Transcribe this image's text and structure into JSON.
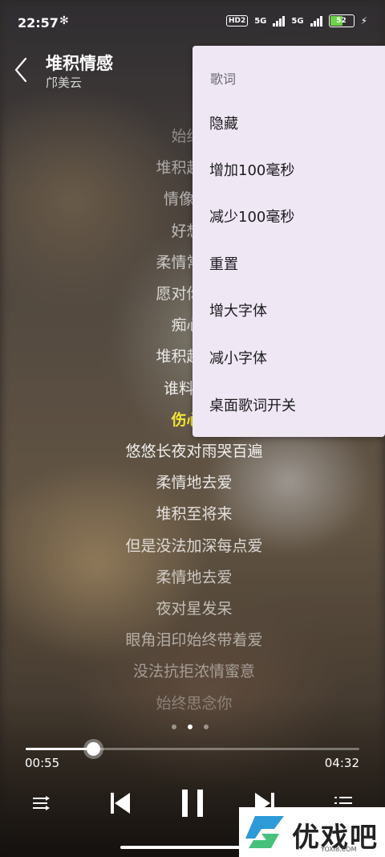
{
  "status_bar": {
    "time": "22:57",
    "hd_label": "HD2",
    "sig1_label": "5G",
    "sig2_label": "5G",
    "battery": "52"
  },
  "header": {
    "title": "堆积情感",
    "artist": "邝美云"
  },
  "lyrics": [
    {
      "text": "始终思",
      "active": false,
      "opacity": 0.45
    },
    {
      "text": "堆积起每分",
      "active": false,
      "opacity": 0.6
    },
    {
      "text": "情像细雨",
      "active": false,
      "opacity": 0.65
    },
    {
      "text": "好想约",
      "active": false,
      "opacity": 0.7
    },
    {
      "text": "柔情常在心",
      "active": false,
      "opacity": 0.75
    },
    {
      "text": "愿对你说声",
      "active": false,
      "opacity": 0.85
    },
    {
      "text": "痴心可",
      "active": false,
      "opacity": 0.9
    },
    {
      "text": "堆积起每分",
      "active": false,
      "opacity": 0.95
    },
    {
      "text": "谁料爱意",
      "active": false,
      "opacity": 1
    },
    {
      "text": "伤心的",
      "active": true,
      "opacity": 1
    },
    {
      "text": "悠悠长夜对雨哭百遍",
      "active": false,
      "opacity": 1
    },
    {
      "text": "柔情地去爱",
      "active": false,
      "opacity": 0.95
    },
    {
      "text": "堆积至将来",
      "active": false,
      "opacity": 0.9
    },
    {
      "text": "但是没法加深每点爱",
      "active": false,
      "opacity": 0.85
    },
    {
      "text": "柔情地去爱",
      "active": false,
      "opacity": 0.75
    },
    {
      "text": "夜对星发呆",
      "active": false,
      "opacity": 0.7
    },
    {
      "text": "眼角泪印始终带着爱",
      "active": false,
      "opacity": 0.6
    },
    {
      "text": "没法抗拒浓情蜜意",
      "active": false,
      "opacity": 0.5
    },
    {
      "text": "始终思念你",
      "active": false,
      "opacity": 0.35
    }
  ],
  "menu": {
    "header": "歌词",
    "items": [
      "隐藏",
      "增加100毫秒",
      "减少100毫秒",
      "重置",
      "增大字体",
      "减小字体",
      "桌面歌词开关"
    ]
  },
  "player": {
    "current_time": "00:55",
    "total_time": "04:32",
    "progress": 0.202
  },
  "controls": {
    "mode_icon": "shuffle-icon",
    "prev_icon": "skip-previous-icon",
    "play_icon": "pause-icon",
    "next_icon": "skip-next-icon",
    "list_icon": "playlist-icon"
  },
  "watermark": {
    "text": "优戏吧",
    "sub": "YOXI8.COM"
  }
}
